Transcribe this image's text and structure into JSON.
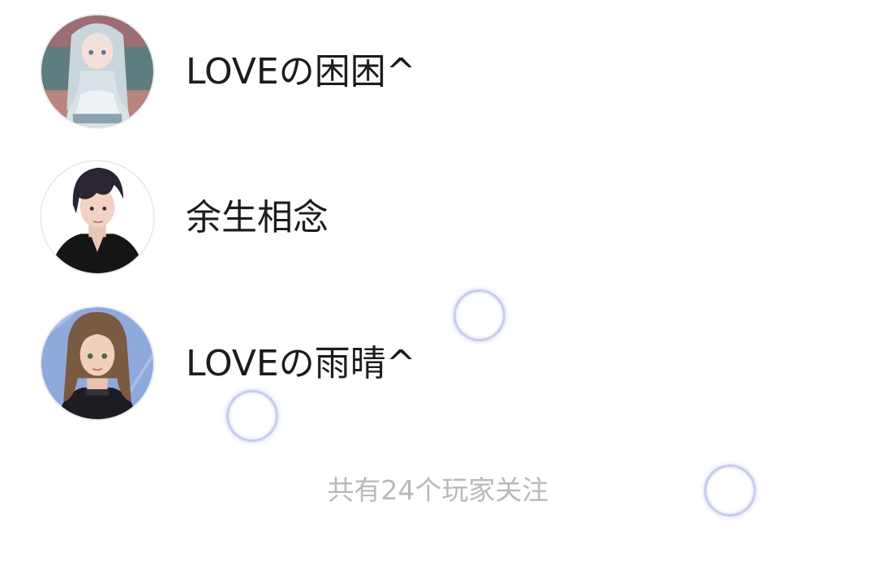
{
  "followers": [
    {
      "name": "LOVEの困困^",
      "avatar": "anime-girl-white-hair-avatar"
    },
    {
      "name": "余生相念",
      "avatar": "dark-haired-man-avatar"
    },
    {
      "name": "LOVEの雨晴^",
      "avatar": "brown-haired-girl-avatar"
    }
  ],
  "footer": {
    "follower_count_text": "共有24个玩家关注"
  },
  "colors": {
    "name_text": "#1c1c1c",
    "footer_text": "#b9b9b9",
    "background": "#ffffff",
    "touch_indicator": "#bec4e8"
  }
}
